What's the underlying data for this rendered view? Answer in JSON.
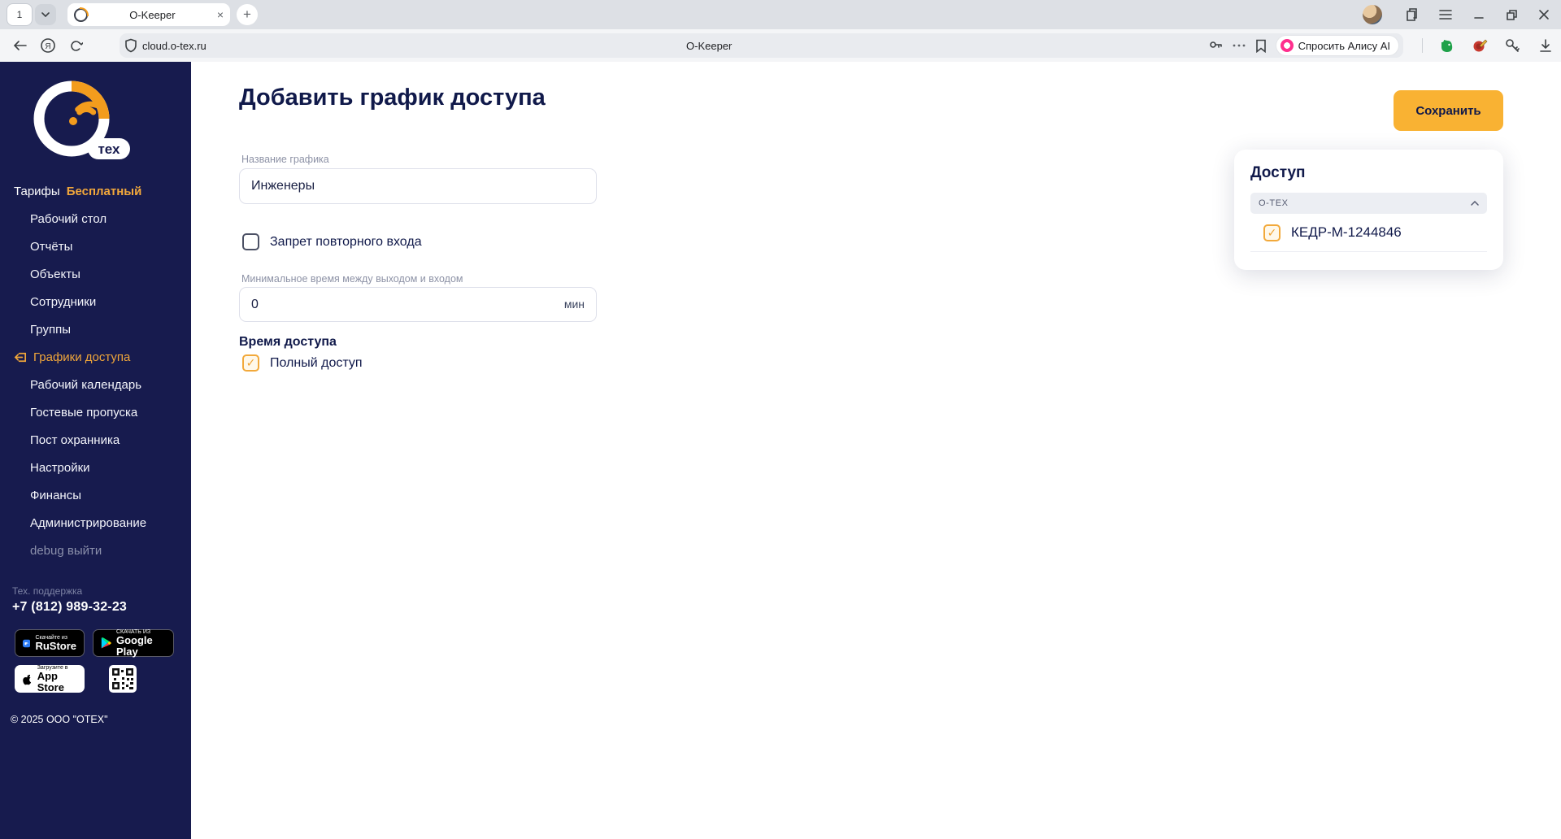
{
  "browser": {
    "tab_counter": "1",
    "tab_title": "O-Keeper",
    "new_tab_label": "+",
    "close_tab_label": "×",
    "url": "cloud.o-tex.ru",
    "page_title_center": "O-Keeper",
    "alice_label": "Спросить Алису AI"
  },
  "sidebar": {
    "logo_text": "тех",
    "tariff_label": "Тарифы",
    "tariff_value": "Бесплатный",
    "items": [
      {
        "label": "Рабочий стол"
      },
      {
        "label": "Отчёты"
      },
      {
        "label": "Объекты"
      },
      {
        "label": "Сотрудники"
      },
      {
        "label": "Группы"
      },
      {
        "label": "Графики доступа",
        "active": true
      },
      {
        "label": "Рабочий календарь"
      },
      {
        "label": "Гостевые пропуска"
      },
      {
        "label": "Пост охранника"
      },
      {
        "label": "Настройки"
      },
      {
        "label": "Финансы"
      },
      {
        "label": "Администрирование"
      },
      {
        "label": "debug выйти",
        "muted": true
      }
    ],
    "support_label": "Тех. поддержка",
    "support_phone": "+7 (812) 989-32-23",
    "badges": {
      "rustore_top": "Скачайте из",
      "rustore_name": "RuStore",
      "gplay_top": "СКАЧАТЬ ИЗ",
      "gplay_name": "Google Play",
      "appstore_top": "Загрузите в",
      "appstore_name": "App Store"
    },
    "copyright": "© 2025 ООО \"ОТЕХ\""
  },
  "main": {
    "title": "Добавить график доступа",
    "save_button": "Сохранить",
    "form": {
      "name_label": "Название графика",
      "name_value": "Инженеры",
      "no_reentry_label": "Запрет повторного входа",
      "min_time_label": "Минимальное время между выходом и входом",
      "min_time_value": "0",
      "min_time_unit": "мин",
      "access_time_label": "Время доступа",
      "full_access_label": "Полный доступ",
      "full_access_check": "✓"
    },
    "access_panel": {
      "title": "Доступ",
      "group": "O-TEX",
      "device": "КЕДР-М-1244846",
      "device_check": "✓"
    }
  },
  "colors": {
    "accent_orange": "#F2A83B",
    "save_button": "#F9B233",
    "sidebar_bg": "#171B4E",
    "text_navy": "#10194A"
  }
}
